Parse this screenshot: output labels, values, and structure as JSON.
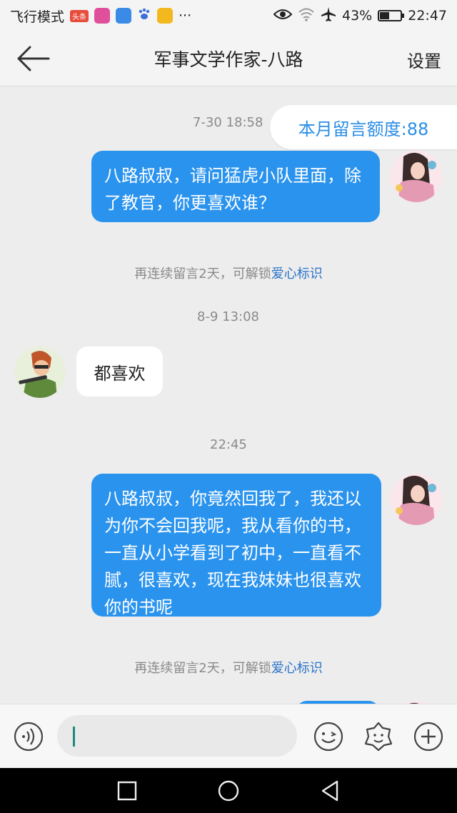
{
  "status_bar": {
    "left_text": "飞行模式",
    "badge": "头条",
    "battery": "43%",
    "battery_level": 0.43,
    "time": "22:47"
  },
  "header": {
    "title": "军事文学作家-八路",
    "settings": "设置"
  },
  "chat": {
    "quota": "本月留言额度:88",
    "messages": [
      {
        "time": "7-30 18:58",
        "text": "八路叔叔，请问猛虎小队里面，除了教官，你更喜欢谁？"
      },
      {
        "notice_prefix": "再连续留言2天，可解锁",
        "notice_link": "爱心标识"
      },
      {
        "time": "8-9 13:08",
        "text": "都喜欢"
      },
      {
        "time": "22:45",
        "text": "八路叔叔，你竟然回我了，我还以为你不会回我呢，我从看你的书，一直从小学看到了初中，一直看不腻，很喜欢，现在我妹妹也很喜欢你的书呢"
      },
      {
        "notice_prefix": "再连续留言2天，可解锁",
        "notice_link": "爱心标识"
      }
    ]
  },
  "colors": {
    "accent": "#2a93ee",
    "link": "#2a73c8",
    "background": "#ededed"
  },
  "input_bar": {
    "icons": [
      "voice-icon",
      "emoji-icon",
      "sticker-icon",
      "plus-icon"
    ]
  },
  "nav_bar": {
    "icons": [
      "recent-apps-icon",
      "home-icon",
      "back-triangle-icon"
    ]
  }
}
